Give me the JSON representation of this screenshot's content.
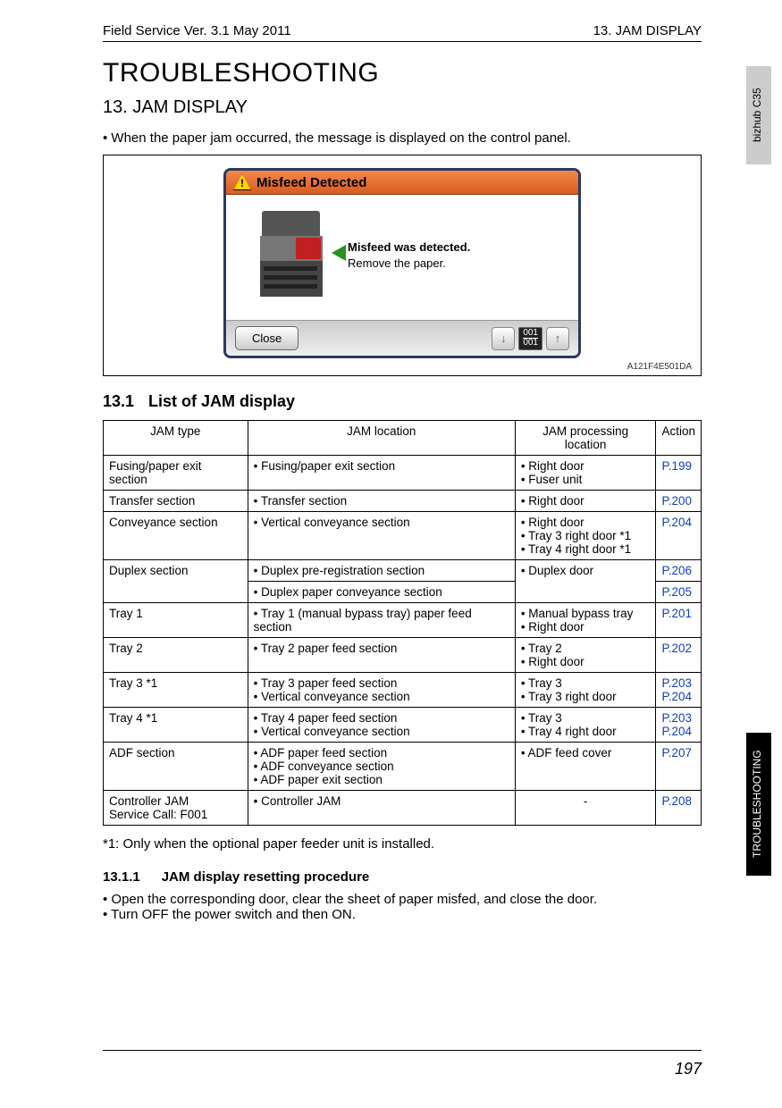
{
  "header": {
    "left": "Field Service Ver. 3.1 May 2011",
    "right": "13. JAM DISPLAY"
  },
  "title": "TROUBLESHOOTING",
  "section": "13.  JAM DISPLAY",
  "intro": "When the paper jam occurred, the message is displayed on the control panel.",
  "panel": {
    "title": "Misfeed Detected",
    "msg_bold": "Misfeed was detected.",
    "msg_line": "Remove the paper.",
    "close": "Close",
    "count_top": "001",
    "count_bot": "001",
    "imgcode": "A121F4E501DA"
  },
  "subsection": {
    "num": "13.1",
    "title": "List of JAM display"
  },
  "table": {
    "headers": [
      "JAM type",
      "JAM location",
      "JAM processing location",
      "Action"
    ],
    "rows": [
      {
        "type": "Fusing/paper exit section",
        "loc": [
          "Fusing/paper exit section"
        ],
        "proc": [
          "Right door",
          "Fuser unit"
        ],
        "action": [
          "P.199"
        ]
      },
      {
        "type": "Transfer section",
        "loc": [
          "Transfer section"
        ],
        "proc": [
          "Right door"
        ],
        "action": [
          "P.200"
        ]
      },
      {
        "type": "Conveyance section",
        "loc": [
          "Vertical conveyance section"
        ],
        "proc": [
          "Right door",
          "Tray 3 right door *1",
          "Tray 4 right door *1"
        ],
        "action": [
          "P.204"
        ]
      },
      {
        "type": "Duplex section",
        "splits": [
          {
            "loc": [
              "Duplex pre-registration section"
            ],
            "action": [
              "P.206"
            ]
          },
          {
            "loc": [
              "Duplex paper conveyance section"
            ],
            "action": [
              "P.205"
            ]
          }
        ],
        "proc": [
          "Duplex door"
        ]
      },
      {
        "type": "Tray 1",
        "loc": [
          "Tray 1 (manual bypass tray) paper feed section"
        ],
        "proc": [
          "Manual bypass tray",
          "Right door"
        ],
        "action": [
          "P.201"
        ]
      },
      {
        "type": "Tray 2",
        "loc": [
          "Tray 2 paper feed section"
        ],
        "proc": [
          "Tray 2",
          "Right door"
        ],
        "action": [
          "P.202"
        ]
      },
      {
        "type": "Tray 3 *1",
        "loc": [
          "Tray 3 paper feed section",
          "Vertical conveyance section"
        ],
        "proc": [
          "Tray 3",
          "Tray 3 right door"
        ],
        "action": [
          "P.203",
          "P.204"
        ]
      },
      {
        "type": "Tray 4 *1",
        "loc": [
          "Tray 4 paper feed section",
          "Vertical conveyance section"
        ],
        "proc": [
          "Tray 3",
          "Tray 4 right door"
        ],
        "action": [
          "P.203",
          "P.204"
        ]
      },
      {
        "type": "ADF section",
        "loc": [
          "ADF paper feed section",
          "ADF conveyance section",
          "ADF paper exit section"
        ],
        "proc": [
          "ADF feed cover"
        ],
        "action": [
          "P.207"
        ]
      },
      {
        "type": "Controller JAM\nService Call: F001",
        "loc": [
          "Controller JAM"
        ],
        "proc_dash": "-",
        "action": [
          "P.208"
        ]
      }
    ]
  },
  "footnote": "*1: Only when the optional paper feeder unit is installed.",
  "subsub": {
    "num": "13.1.1",
    "title": "JAM display resetting procedure"
  },
  "steps": [
    "Open the corresponding door, clear the sheet of paper misfed, and close the door.",
    "Turn OFF the power switch and then ON."
  ],
  "pagenum": "197",
  "tabs": {
    "light": "bizhub C35",
    "dark": "TROUBLESHOOTING"
  }
}
